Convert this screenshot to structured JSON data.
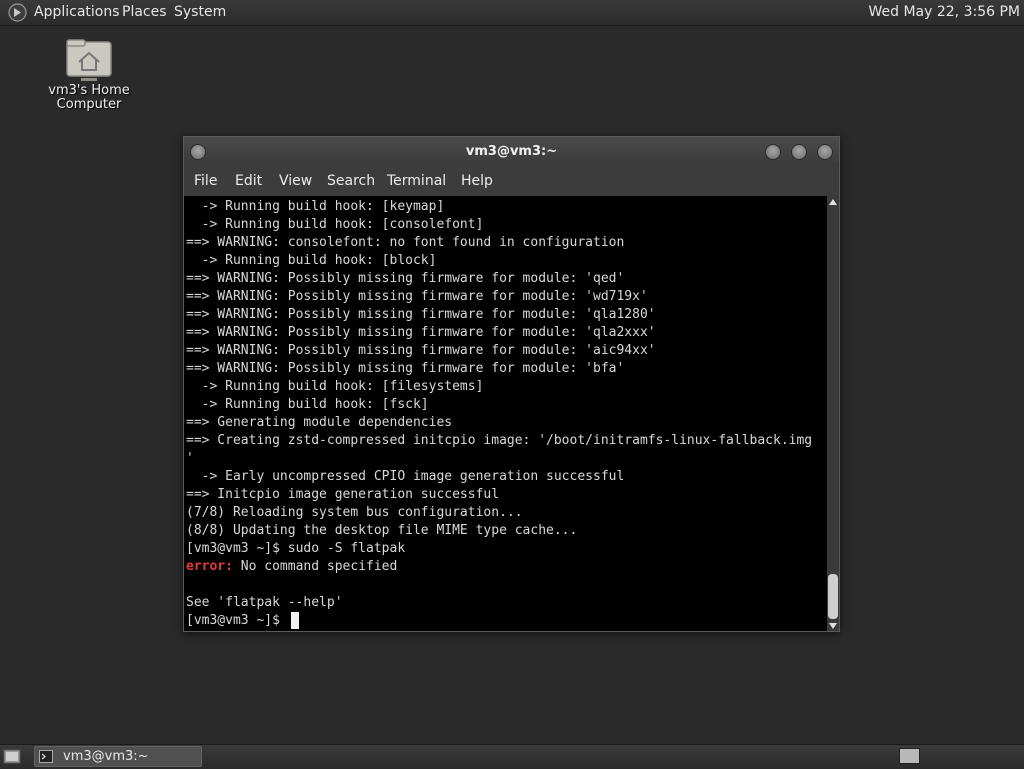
{
  "top_panel": {
    "menus": [
      "Applications",
      "Places",
      "System"
    ],
    "clock": "Wed May 22,  3:56 PM"
  },
  "desktop": {
    "icon_label_1": "vm3's Home",
    "icon_label_2": "Computer"
  },
  "window": {
    "title": "vm3@vm3:~",
    "menus": [
      "File",
      "Edit",
      "View",
      "Search",
      "Terminal",
      "Help"
    ]
  },
  "terminal": {
    "lines": [
      "  -> Running build hook: [keymap]",
      "  -> Running build hook: [consolefont]",
      "==> WARNING: consolefont: no font found in configuration",
      "  -> Running build hook: [block]",
      "==> WARNING: Possibly missing firmware for module: 'qed'",
      "==> WARNING: Possibly missing firmware for module: 'wd719x'",
      "==> WARNING: Possibly missing firmware for module: 'qla1280'",
      "==> WARNING: Possibly missing firmware for module: 'qla2xxx'",
      "==> WARNING: Possibly missing firmware for module: 'aic94xx'",
      "==> WARNING: Possibly missing firmware for module: 'bfa'",
      "  -> Running build hook: [filesystems]",
      "  -> Running build hook: [fsck]",
      "==> Generating module dependencies",
      "==> Creating zstd-compressed initcpio image: '/boot/initramfs-linux-fallback.img",
      "'",
      "  -> Early uncompressed CPIO image generation successful",
      "==> Initcpio image generation successful",
      "(7/8) Reloading system bus configuration...",
      "(8/8) Updating the desktop file MIME type cache...",
      "[vm3@vm3 ~]$ sudo -S flatpak",
      "",
      "",
      "See 'flatpak --help'",
      "[vm3@vm3 ~]$ "
    ],
    "error_prefix": "error:",
    "error_message": " No command specified"
  },
  "bottom_panel": {
    "task_label": "vm3@vm3:~"
  },
  "colors": {
    "error": "#e33b3b",
    "terminal_bg": "#000000",
    "terminal_fg": "#d8d8d8"
  }
}
